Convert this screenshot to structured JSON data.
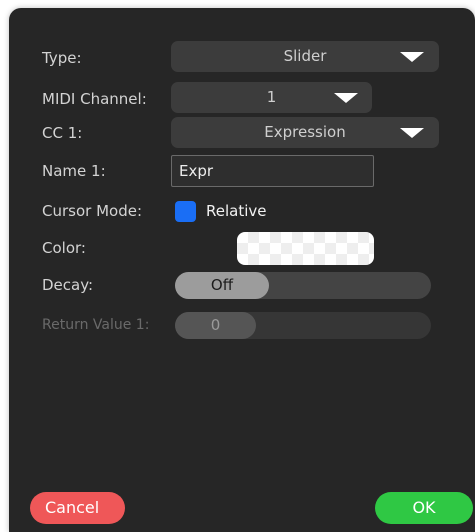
{
  "colors": {
    "accent": "#1a6ef5",
    "cancel": "#ef5758",
    "ok": "#2fc844",
    "background": "#262626"
  },
  "fields": {
    "type_label": "Type:",
    "type_value": "Slider",
    "midi_label": "MIDI Channel:",
    "midi_value": "1",
    "cc_label": "CC 1:",
    "cc_value": "Expression",
    "name_label": "Name 1:",
    "name_value": "Expr",
    "cursor_label": "Cursor Mode:",
    "cursor_option": "Relative",
    "cursor_checked": true,
    "color_label": "Color:",
    "decay_label": "Decay:",
    "decay_value": "Off",
    "return_label": "Return Value 1:",
    "return_value": "0"
  },
  "buttons": {
    "cancel": "Cancel",
    "ok": "OK"
  }
}
